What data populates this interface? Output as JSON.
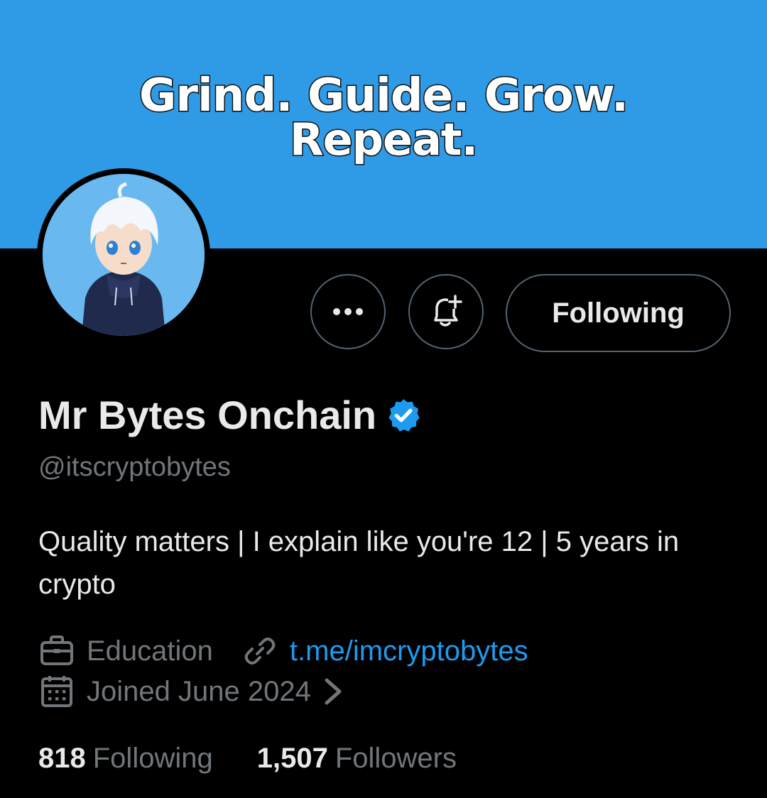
{
  "banner": {
    "line1": "Grind.  Guide. Grow.",
    "line2": "Repeat.",
    "background_color": "#2f9ae6"
  },
  "avatar": {
    "icon": "avatar-cartoon-boy-hoodie"
  },
  "actions": {
    "more_icon": "more-dots-icon",
    "notify_icon": "bell-plus-icon",
    "following_label": "Following"
  },
  "profile": {
    "display_name": "Mr Bytes Onchain",
    "verified_icon": "verified-badge-icon",
    "verified_color": "#1d9bf0",
    "handle": "@itscryptobytes",
    "bio": "Quality matters | I explain like you're 12 | 5 years in crypto",
    "category_icon": "briefcase-icon",
    "category": "Education",
    "link_icon": "link-icon",
    "link": "t.me/imcryptobytes",
    "link_color": "#1d9bf0",
    "joined_icon": "calendar-icon",
    "joined": "Joined June 2024"
  },
  "stats": {
    "following_count": "818",
    "following_label": "Following",
    "followers_count": "1,507",
    "followers_label": "Followers"
  }
}
